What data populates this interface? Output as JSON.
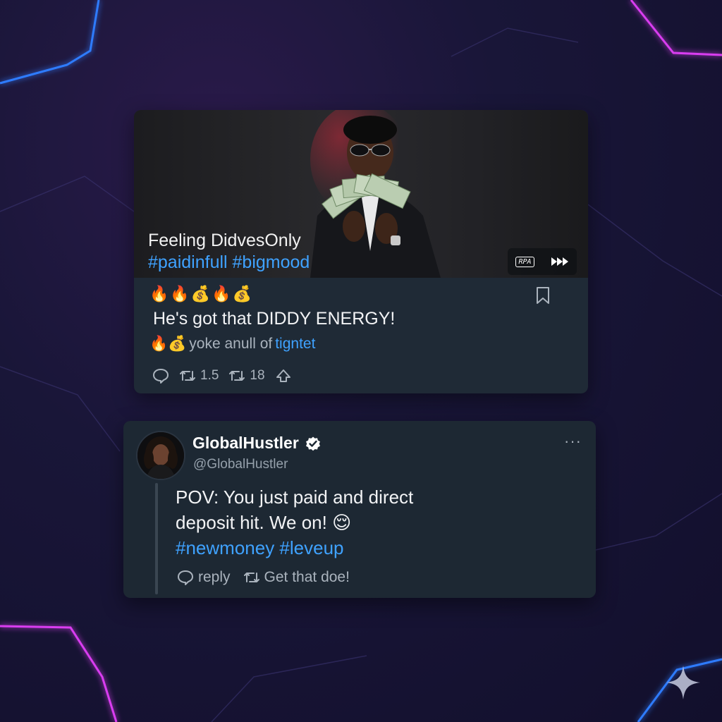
{
  "post1": {
    "media_caption_line1": "Feeling DidvesOnly",
    "media_caption_line2": "#paidinfull #bigmood",
    "media_button_label": "RPA",
    "media_ff_icon": "fast-forward-icon",
    "emoji_row": "🔥🔥💰🔥💰",
    "headline": "He's got that DIDDY ENERGY!",
    "sub_emoji": "🔥💰",
    "sub_text": "yoke anull of ",
    "sub_link": "tigntet",
    "retweet_count": "1.5",
    "quote_count": "18"
  },
  "post2": {
    "display_name": "GlobalHustler",
    "handle": "@GlobalHustler",
    "more_label": "···",
    "text_line1": "POV: You just paid and direct",
    "text_line2": "deposit hit. We on! 😌",
    "hashtags": "#newmoney #leveup",
    "reply_label": "reply",
    "retweet_label": "Get that doe!"
  },
  "colors": {
    "accent": "#3fa2ff",
    "card_bg": "#1f2a36",
    "neon_blue": "#2f7bff",
    "neon_magenta": "#d93cf0"
  }
}
